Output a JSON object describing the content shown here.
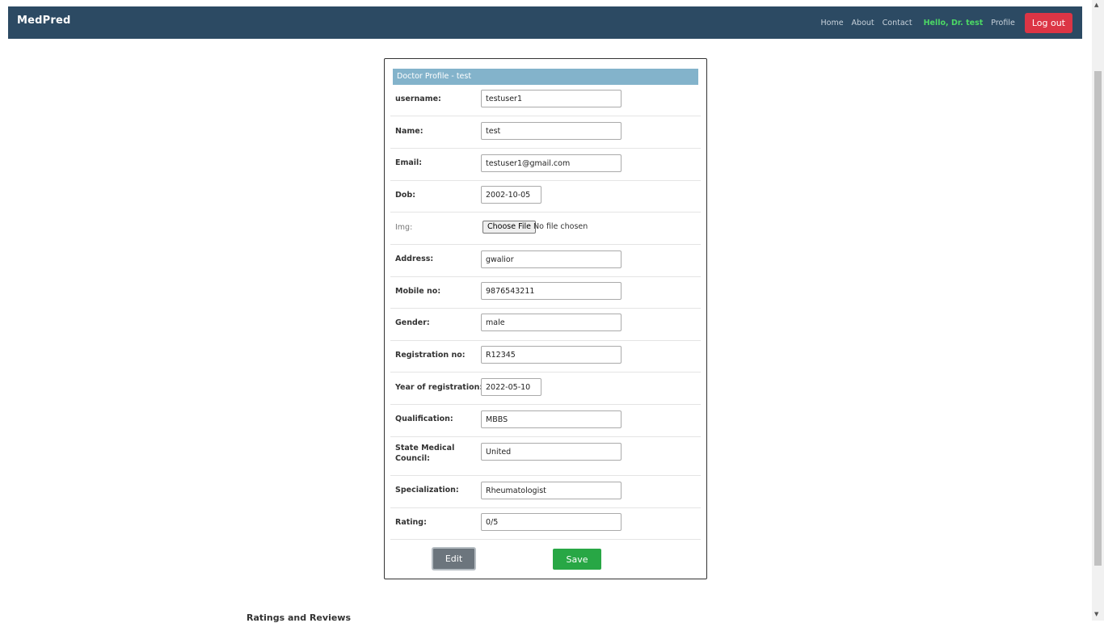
{
  "navbar": {
    "brand": "MedPred",
    "links": [
      "Home",
      "About",
      "Contact"
    ],
    "greeting": "Hello, Dr. test",
    "profile": "Profile",
    "logout": "Log out"
  },
  "profile": {
    "header": "Doctor Profile - test",
    "username": {
      "label": "username:",
      "value": "testuser1"
    },
    "name": {
      "label": "Name:",
      "value": "test"
    },
    "email": {
      "label": "Email:",
      "value": "testuser1@gmail.com"
    },
    "dob": {
      "label": "Dob:",
      "value": "2002-10-05"
    },
    "img": {
      "label": "Img:",
      "button": "Choose File",
      "status": "No file chosen"
    },
    "address": {
      "label": "Address:",
      "value": "gwalior"
    },
    "mobile": {
      "label": "Mobile no:",
      "value": "9876543211"
    },
    "gender": {
      "label": "Gender:",
      "value": "male"
    },
    "registration_no": {
      "label": "Registration no:",
      "value": "R12345"
    },
    "year_of_registration": {
      "label": "Year of registration:",
      "value": "2022-05-10"
    },
    "qualification": {
      "label": "Qualification:",
      "value": "MBBS"
    },
    "state_medical_council": {
      "label": "State Medical Council:",
      "value": "United"
    },
    "specialization": {
      "label": "Specialization:",
      "value": "Rheumatologist"
    },
    "rating": {
      "label": "Rating:",
      "value": "0/5"
    },
    "edit_label": "Edit",
    "save_label": "Save"
  },
  "reviews": {
    "heading": "Ratings and Reviews"
  }
}
